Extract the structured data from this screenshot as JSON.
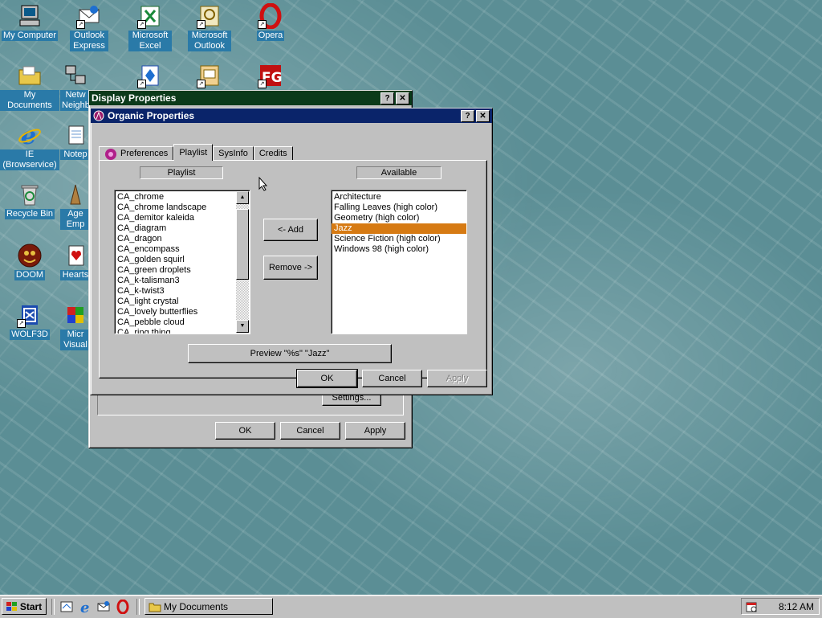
{
  "desktop": {
    "icons": [
      {
        "label": "My Computer",
        "icon": "my-computer-icon"
      },
      {
        "label": "Outlook Express",
        "icon": "outlook-express-icon"
      },
      {
        "label": "Microsoft Excel",
        "icon": "excel-icon"
      },
      {
        "label": "Microsoft Outlook",
        "icon": "outlook-icon"
      },
      {
        "label": "Opera",
        "icon": "opera-icon"
      },
      {
        "label": "My Documents",
        "icon": "folder-icon"
      },
      {
        "label": "Netw Neighb",
        "icon": "network-icon"
      },
      {
        "label": "IE (Browservice)",
        "icon": "ie-icon"
      },
      {
        "label": "Notep",
        "icon": "notepad-icon"
      },
      {
        "label": "Recycle Bin",
        "icon": "recycle-bin-icon"
      },
      {
        "label": "Age Emp",
        "icon": "age-of-empires-icon"
      },
      {
        "label": "DOOM",
        "icon": "doom-icon"
      },
      {
        "label": "Hearts",
        "icon": "hearts-icon"
      },
      {
        "label": "WOLF3D",
        "icon": "wolf3d-icon"
      },
      {
        "label": "Micr Visual",
        "icon": "visual-studio-icon"
      }
    ]
  },
  "display_properties": {
    "title": "Display Properties",
    "settings_label": "Settings...",
    "ok_label": "OK",
    "cancel_label": "Cancel",
    "apply_label": "Apply"
  },
  "organic": {
    "title": "Organic Properties",
    "tabs": [
      {
        "label": "Preferences",
        "selected": false
      },
      {
        "label": "Playlist",
        "selected": true
      },
      {
        "label": "SysInfo",
        "selected": false
      },
      {
        "label": "Credits",
        "selected": false
      }
    ],
    "playlist_header": "Playlist",
    "available_header": "Available",
    "playlist_items": [
      "CA_chrome",
      "CA_chrome landscape",
      "CA_demitor kaleida",
      "CA_diagram",
      "CA_dragon",
      "CA_encompass",
      "CA_golden squirl",
      "CA_green droplets",
      "CA_k-talisman3",
      "CA_k-twist3",
      "CA_light crystal",
      "CA_lovely butterflies",
      "CA_pebble cloud",
      "CA_ring thing"
    ],
    "available_items": [
      "Architecture",
      "Falling Leaves (high color)",
      "Geometry (high color)",
      "Jazz",
      "Science Fiction (high color)",
      "Windows 98 (high color)"
    ],
    "selected_available": "Jazz",
    "add_label": "<- Add",
    "remove_label": "Remove ->",
    "preview_label": "Preview \"%s\" \"Jazz\"",
    "ok_label": "OK",
    "cancel_label": "Cancel",
    "apply_label": "Apply"
  },
  "taskbar": {
    "start_label": "Start",
    "task_label": "My Documents",
    "clock": "8:12 AM"
  }
}
